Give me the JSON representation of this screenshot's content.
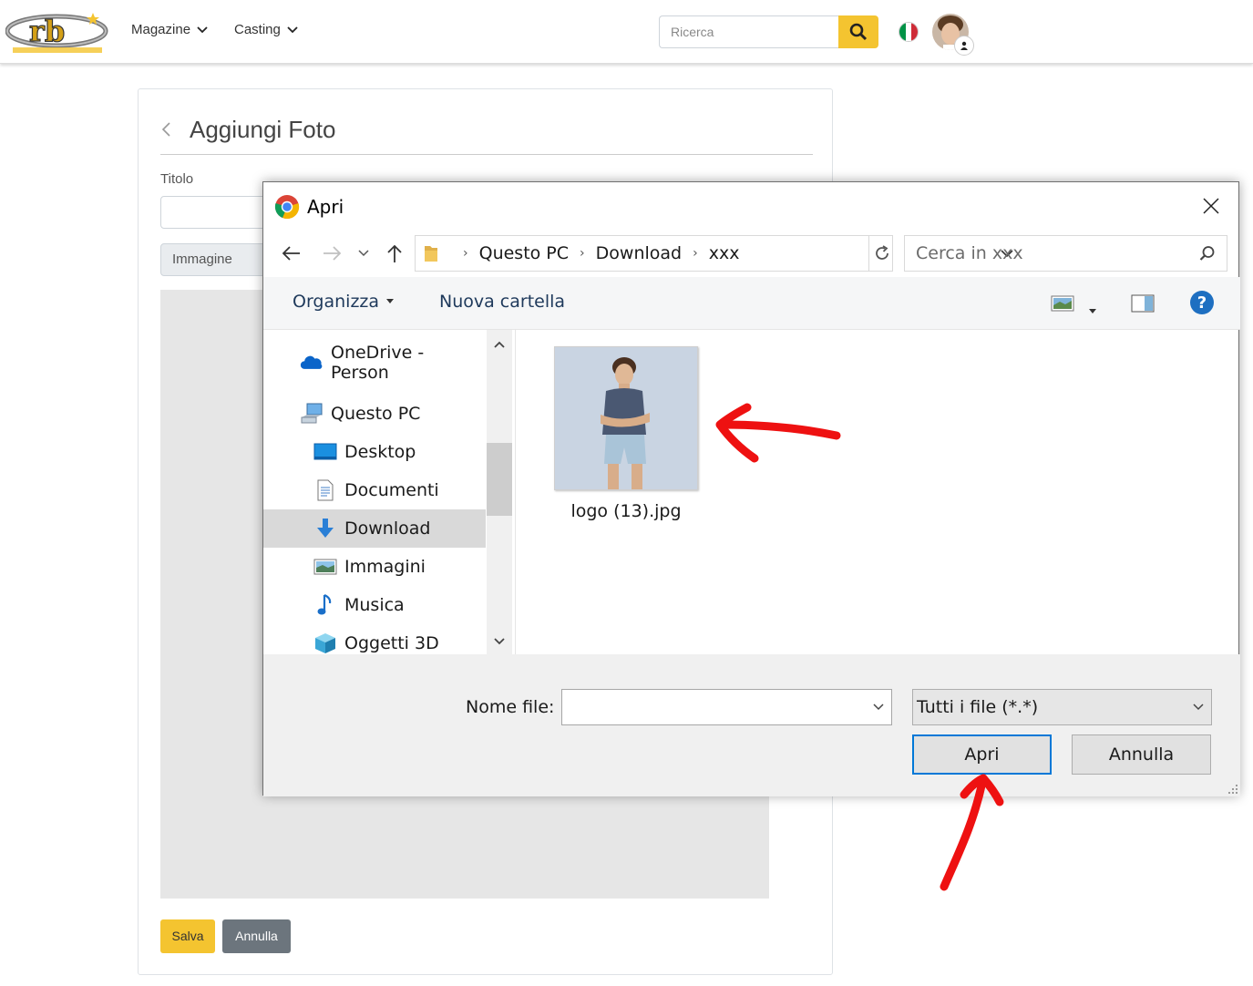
{
  "site": {
    "nav": {
      "magazine": "Magazine",
      "casting": "Casting"
    },
    "search_placeholder": "Ricerca",
    "flag_colors": [
      "#009246",
      "#ffffff",
      "#ce2b37"
    ],
    "accent": "#f4c430"
  },
  "card": {
    "title": "Aggiungi Foto",
    "titolo_label": "Titolo",
    "file_label": "Immagine",
    "save_label": "Salva",
    "cancel_label": "Annulla"
  },
  "dialog": {
    "title": "Apri",
    "breadcrumb": [
      "Questo PC",
      "Download",
      "xxx"
    ],
    "search_placeholder": "Cerca in xxx",
    "toolbar": {
      "organize": "Organizza",
      "new_folder": "Nuova cartella"
    },
    "tree": [
      {
        "label": "OneDrive - Person",
        "icon": "onedrive-icon"
      },
      {
        "label": "Questo PC",
        "icon": "computer-icon"
      },
      {
        "label": "Desktop",
        "icon": "desktop-icon"
      },
      {
        "label": "Documenti",
        "icon": "documents-icon"
      },
      {
        "label": "Download",
        "icon": "download-icon",
        "selected": true
      },
      {
        "label": "Immagini",
        "icon": "pictures-icon"
      },
      {
        "label": "Musica",
        "icon": "music-icon"
      },
      {
        "label": "Oggetti 3D",
        "icon": "objects-3d-icon"
      }
    ],
    "file": {
      "name": "logo (13).jpg"
    },
    "filename_label": "Nome file:",
    "filename_value": "",
    "filter_value": "Tutti i file (*.*)",
    "open_label": "Apri",
    "cancel_label": "Annulla"
  },
  "annotations": {
    "arrow_color": "#ee1111"
  }
}
